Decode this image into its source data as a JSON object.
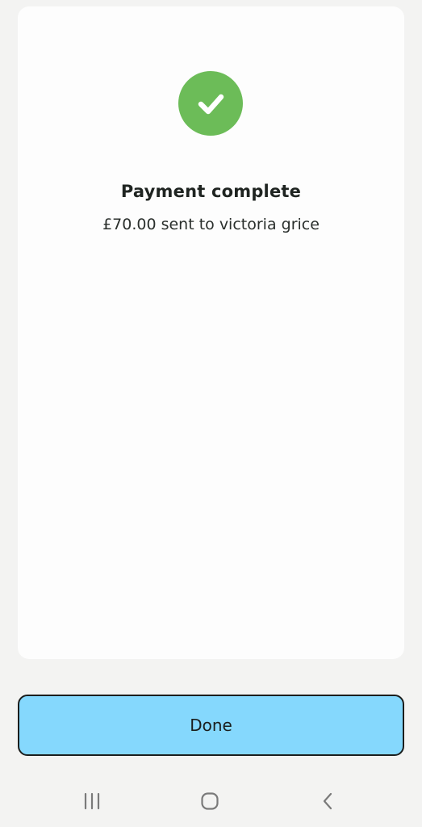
{
  "colors": {
    "background": "#f3f3f2",
    "card": "#fdfdfd",
    "success_green": "#6cbc58",
    "button_fill": "#85d8fd",
    "button_border": "#1b1e1d",
    "text": "#1f2421",
    "nav_icon": "#7a7a7a"
  },
  "confirmation": {
    "icon": "check-circle-icon",
    "title": "Payment complete",
    "message": "£70.00 sent to victoria grice"
  },
  "actions": {
    "done_label": "Done"
  },
  "navigation": {
    "icons": [
      "recents-icon",
      "home-icon",
      "back-icon"
    ]
  }
}
